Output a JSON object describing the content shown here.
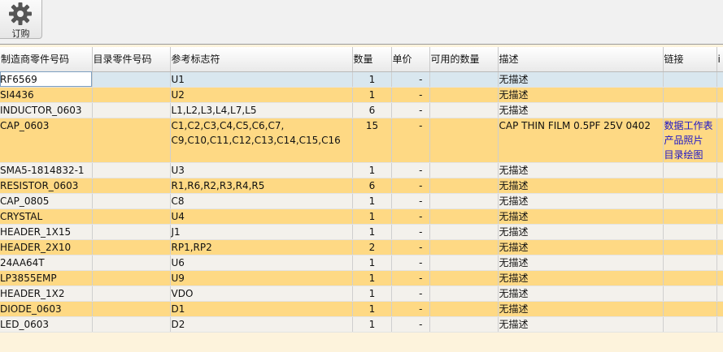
{
  "toolbar": {
    "order_label": "订购"
  },
  "columns": [
    "制造商零件号码",
    "目录零件号码",
    "参考标志符",
    "数量",
    "单价",
    "可用的数量",
    "描述",
    "链接",
    "i"
  ],
  "rows": [
    {
      "mfr": "RF6569",
      "cat": "",
      "ref": "U1",
      "qty": "1",
      "price": "-",
      "avail": "",
      "desc": "无描述",
      "links": []
    },
    {
      "mfr": "SI4436",
      "cat": "",
      "ref": "U2",
      "qty": "1",
      "price": "-",
      "avail": "",
      "desc": "无描述",
      "links": []
    },
    {
      "mfr": "INDUCTOR_0603",
      "cat": "",
      "ref": "L1,L2,L3,L4,L7,L5",
      "qty": "6",
      "price": "-",
      "avail": "",
      "desc": "无描述",
      "links": []
    },
    {
      "mfr": "CAP_0603",
      "cat": "",
      "ref": "C1,C2,C3,C4,C5,C6,C7,",
      "ref2": "C9,C10,C11,C12,C13,C14,C15,C16",
      "qty": "15",
      "price": "-",
      "avail": "",
      "desc": "CAP THIN FILM 0.5PF 25V 0402",
      "links": [
        "数据工作表",
        "产品照片",
        "目录绘图"
      ]
    },
    {
      "mfr": "SMA5-1814832-1",
      "cat": "",
      "ref": "U3",
      "qty": "1",
      "price": "-",
      "avail": "",
      "desc": "无描述",
      "links": []
    },
    {
      "mfr": "RESISTOR_0603",
      "cat": "",
      "ref": "R1,R6,R2,R3,R4,R5",
      "qty": "6",
      "price": "-",
      "avail": "",
      "desc": "无描述",
      "links": []
    },
    {
      "mfr": "CAP_0805",
      "cat": "",
      "ref": "C8",
      "qty": "1",
      "price": "-",
      "avail": "",
      "desc": "无描述",
      "links": []
    },
    {
      "mfr": "CRYSTAL",
      "cat": "",
      "ref": "U4",
      "qty": "1",
      "price": "-",
      "avail": "",
      "desc": "无描述",
      "links": []
    },
    {
      "mfr": "HEADER_1X15",
      "cat": "",
      "ref": "J1",
      "qty": "1",
      "price": "-",
      "avail": "",
      "desc": "无描述",
      "links": []
    },
    {
      "mfr": "HEADER_2X10",
      "cat": "",
      "ref": "RP1,RP2",
      "qty": "2",
      "price": "-",
      "avail": "",
      "desc": "无描述",
      "links": []
    },
    {
      "mfr": "24AA64T",
      "cat": "",
      "ref": "U6",
      "qty": "1",
      "price": "-",
      "avail": "",
      "desc": "无描述",
      "links": []
    },
    {
      "mfr": "LP3855EMP",
      "cat": "",
      "ref": "U9",
      "qty": "1",
      "price": "-",
      "avail": "",
      "desc": "无描述",
      "links": []
    },
    {
      "mfr": "HEADER_1X2",
      "cat": "",
      "ref": "VDO",
      "qty": "1",
      "price": "-",
      "avail": "",
      "desc": "无描述",
      "links": []
    },
    {
      "mfr": "DIODE_0603",
      "cat": "",
      "ref": "D1",
      "qty": "1",
      "price": "-",
      "avail": "",
      "desc": "无描述",
      "links": []
    },
    {
      "mfr": "LED_0603",
      "cat": "",
      "ref": "D2",
      "qty": "1",
      "price": "-",
      "avail": "",
      "desc": "无描述",
      "links": []
    }
  ],
  "icons": {
    "order": "gear-icon"
  }
}
